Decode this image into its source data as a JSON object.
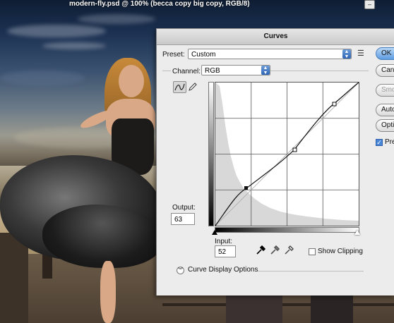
{
  "document": {
    "title": "modern-fly.psd @ 100% (becca copy big copy, RGB/8)",
    "minimize_label": "–"
  },
  "dialog": {
    "title": "Curves",
    "preset_label": "Preset:",
    "preset_value": "Custom",
    "channel_label": "Channel:",
    "channel_value": "RGB",
    "output_label": "Output:",
    "output_value": "63",
    "input_label": "Input:",
    "input_value": "52",
    "show_clipping_label": "Show Clipping",
    "show_clipping_checked": false,
    "curve_display_options_label": "Curve Display Options",
    "buttons": {
      "ok": "OK",
      "cancel": "Cancel",
      "smooth": "Smooth",
      "auto": "Auto",
      "options": "Options...",
      "preview": "Preview"
    },
    "preview_checked": true
  }
}
